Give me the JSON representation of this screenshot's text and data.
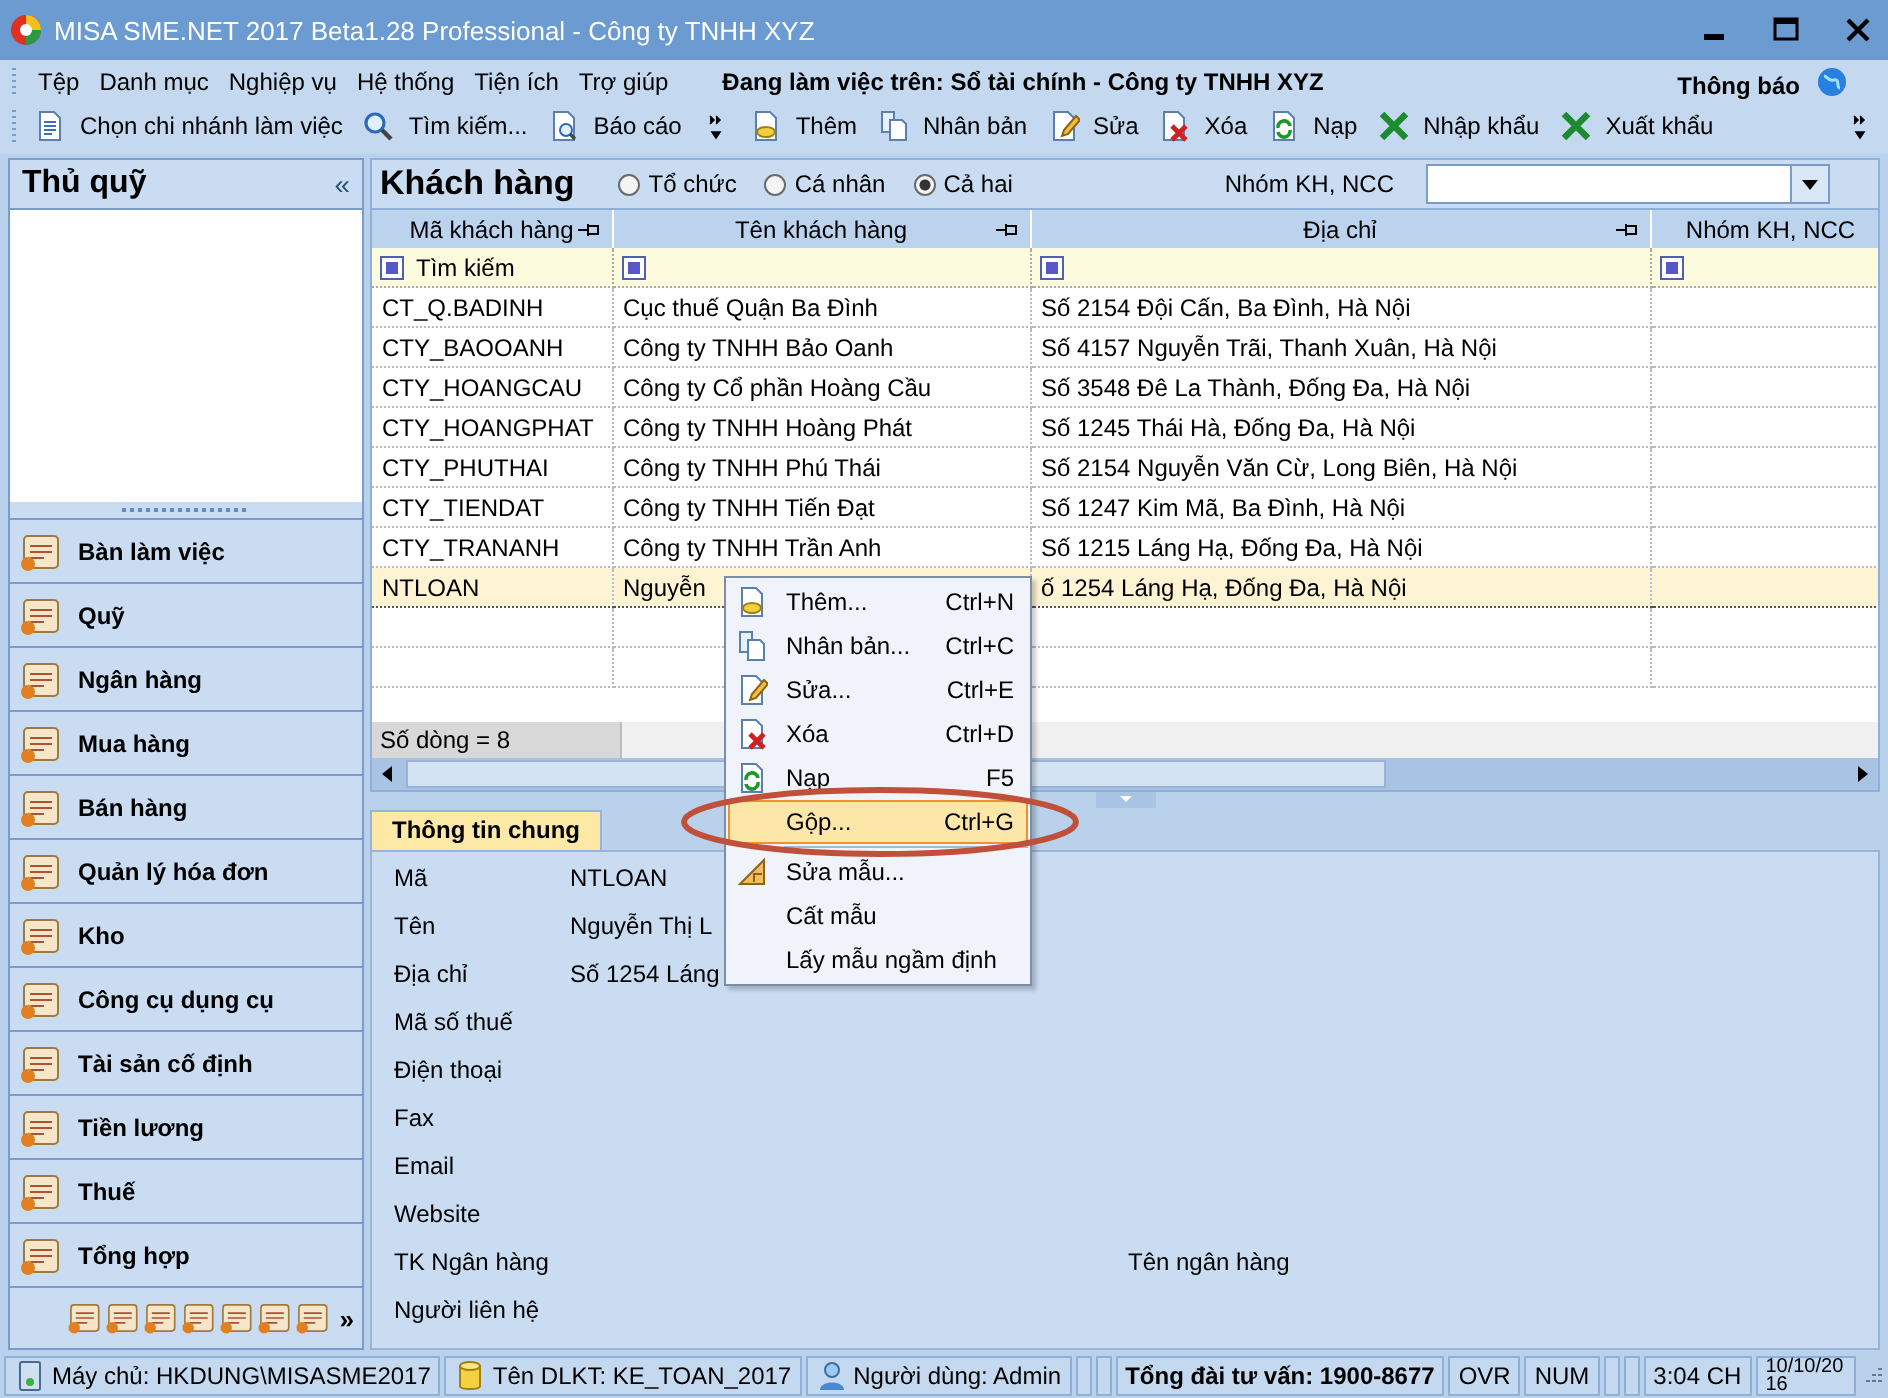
{
  "window": {
    "title": "MISA SME.NET 2017 Beta1.28 Professional - Công ty TNHH XYZ"
  },
  "menu": [
    "Tệp",
    "Danh mục",
    "Nghiệp vụ",
    "Hệ thống",
    "Tiện ích",
    "Trợ giúp"
  ],
  "working_on": "Đang làm việc trên: Sổ tài chính - Công ty TNHH XYZ",
  "notifications": "Thông báo",
  "toolbar_left": [
    {
      "label": "Chọn chi nhánh làm việc",
      "kind": "doc"
    },
    {
      "label": "Tìm kiếm...",
      "kind": "search"
    },
    {
      "label": "Báo cáo",
      "kind": "report"
    }
  ],
  "toolbar_right": [
    {
      "label": "Thêm",
      "kind": "add"
    },
    {
      "label": "Nhân bản",
      "kind": "copy"
    },
    {
      "label": "Sửa",
      "kind": "edit"
    },
    {
      "label": "Xóa",
      "kind": "delete"
    },
    {
      "label": "Nạp",
      "kind": "refresh"
    },
    {
      "label": "Nhập khẩu",
      "kind": "excel"
    },
    {
      "label": "Xuất khẩu",
      "kind": "excel"
    }
  ],
  "sidebar": {
    "title": "Thủ quỹ",
    "collapse": "«",
    "modules": [
      "Bàn làm việc",
      "Quỹ",
      "Ngân hàng",
      "Mua hàng",
      "Bán hàng",
      "Quản lý hóa đơn",
      "Kho",
      "Công cụ dụng cụ",
      "Tài sản cố định",
      "Tiền lương",
      "Thuế",
      "Tổng hợp"
    ],
    "more": "»"
  },
  "customers": {
    "title": "Khách hàng",
    "filter_options": [
      {
        "label": "Tổ chức",
        "selected": false
      },
      {
        "label": "Cá nhân",
        "selected": false
      },
      {
        "label": "Cả hai",
        "selected": true
      }
    ],
    "group_label": "Nhóm KH, NCC",
    "columns": [
      "Mã khách hàng",
      "Tên khách hàng",
      "Địa chỉ",
      "Nhóm KH, NCC"
    ],
    "search_placeholder": "Tìm kiếm",
    "rows": [
      {
        "cells": [
          "CT_Q.BADINH",
          "Cục thuế Quận Ba Đình",
          "Số 2154 Đội Cấn, Ba Đình, Hà Nội"
        ],
        "selected": false
      },
      {
        "cells": [
          "CTY_BAOOANH",
          "Công ty TNHH Bảo Oanh",
          "Số 4157 Nguyễn Trãi, Thanh Xuân, Hà Nội"
        ],
        "selected": false
      },
      {
        "cells": [
          "CTY_HOANGCAU",
          "Công ty Cổ phần Hoàng Cầu",
          "Số 3548 Đê La Thành, Đống Đa, Hà Nội"
        ],
        "selected": false
      },
      {
        "cells": [
          "CTY_HOANGPHAT",
          "Công ty TNHH Hoàng Phát",
          "Số 1245 Thái Hà, Đống Đa, Hà Nội"
        ],
        "selected": false
      },
      {
        "cells": [
          "CTY_PHUTHAI",
          "Công ty TNHH Phú Thái",
          "Số 2154 Nguyễn Văn Cừ, Long Biên, Hà Nội"
        ],
        "selected": false
      },
      {
        "cells": [
          "CTY_TIENDAT",
          "Công ty TNHH Tiến Đạt",
          "Số 1247 Kim Mã, Ba Đình, Hà Nội"
        ],
        "selected": false
      },
      {
        "cells": [
          "CTY_TRANANH",
          "Công ty TNHH Trần Anh",
          "Số 1215 Láng Hạ, Đống Đa, Hà Nội"
        ],
        "selected": false
      },
      {
        "cells": [
          "NTLOAN",
          "Nguyễn",
          "ố 1254 Láng Hạ, Đống Đa, Hà Nội"
        ],
        "selected": true
      }
    ],
    "row_count": "Số dòng = 8"
  },
  "context_menu": {
    "groups": [
      [
        {
          "label": "Thêm...",
          "shortcut": "Ctrl+N",
          "kind": "add",
          "highlighted": false
        },
        {
          "label": "Nhân bản...",
          "shortcut": "Ctrl+C",
          "kind": "copy",
          "highlighted": false
        },
        {
          "label": "Sửa...",
          "shortcut": "Ctrl+E",
          "kind": "edit",
          "highlighted": false
        },
        {
          "label": "Xóa",
          "shortcut": "Ctrl+D",
          "kind": "delete",
          "highlighted": false
        },
        {
          "label": "Nạp",
          "shortcut": "F5",
          "kind": "refresh",
          "highlighted": false
        },
        {
          "label": "Gộp...",
          "shortcut": "Ctrl+G",
          "kind": "plain",
          "highlighted": true
        }
      ],
      [
        {
          "label": "Sửa mẫu...",
          "kind": "ruler",
          "highlighted": false
        },
        {
          "label": "Cất mẫu",
          "kind": "plain",
          "highlighted": false
        },
        {
          "label": "Lấy mẫu ngầm định",
          "kind": "plain",
          "highlighted": false
        }
      ]
    ]
  },
  "details": {
    "tab": "Thông tin chung",
    "fields": [
      {
        "label": "Mã",
        "value": "NTLOAN"
      },
      {
        "label": "Tên",
        "value": "Nguyễn Thị L"
      },
      {
        "label": "Địa chỉ",
        "value": "Số 1254 Láng"
      },
      {
        "label": "Mã số thuế"
      },
      {
        "label": "Điện thoại"
      },
      {
        "label": "Fax"
      },
      {
        "label": "Email"
      },
      {
        "label": "Website"
      },
      {
        "label": "TK Ngân hàng",
        "side_label": "Tên ngân hàng"
      },
      {
        "label": "Người liên hệ"
      }
    ]
  },
  "status_bar": [
    {
      "kind": "server",
      "text": "Máy chủ: HKDUNG\\MISASME2017"
    },
    {
      "kind": "database",
      "text": "Tên DLKT: KE_TOAN_2017"
    },
    {
      "kind": "user",
      "text": "Người dùng: Admin"
    },
    {
      "kind": "empty"
    },
    {
      "kind": "empty"
    },
    {
      "kind": "bold",
      "text": "Tổng đài tư vấn: 1900-8677"
    },
    {
      "kind": "text",
      "text": "OVR"
    },
    {
      "kind": "text",
      "text": "NUM"
    },
    {
      "kind": "empty"
    },
    {
      "kind": "empty"
    },
    {
      "kind": "text",
      "text": "3:04 CH"
    },
    {
      "kind": "date",
      "text": "10/10/2016"
    }
  ]
}
